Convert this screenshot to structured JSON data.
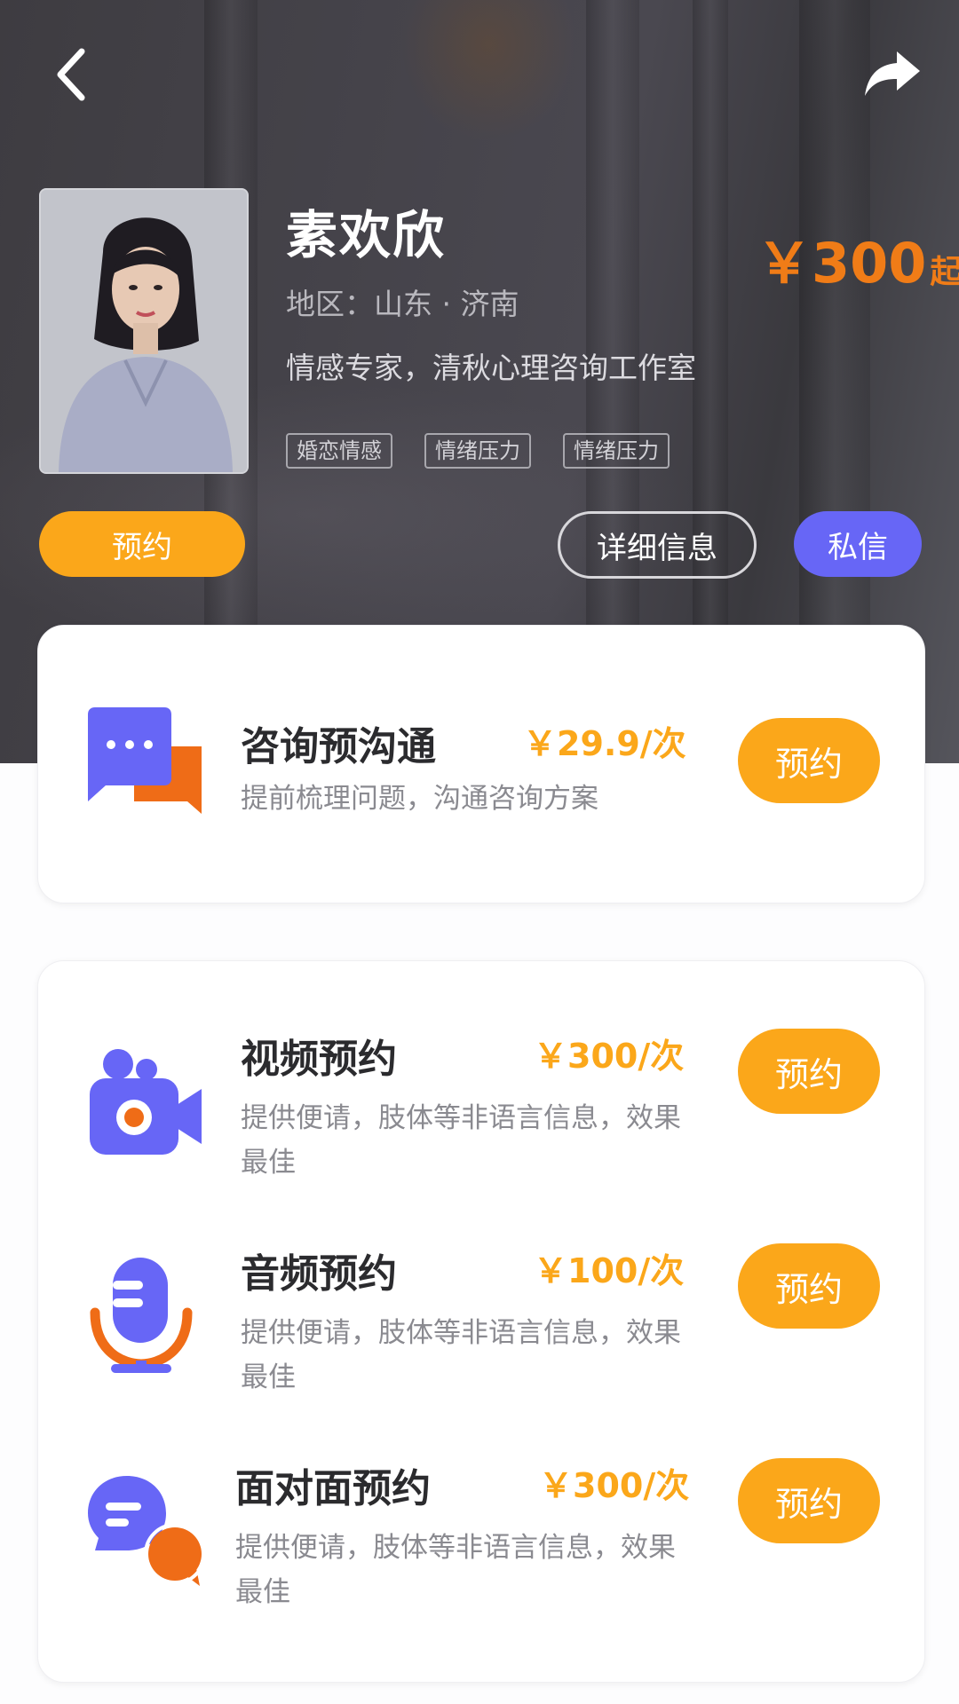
{
  "header": {
    "back_icon": "chevron-left-icon",
    "share_icon": "share-arrow-icon"
  },
  "profile": {
    "name": "素欢欣",
    "region": "地区：山东 · 济南",
    "title": "情感专家，清秋心理咨询工作室",
    "tags": [
      "婚恋情感",
      "情绪压力",
      "情绪压力"
    ],
    "price": "￥300",
    "price_suffix": "起",
    "book_label": "预约",
    "detail_label": "详细信息",
    "message_label": "私信"
  },
  "colors": {
    "accent_orange": "#fba71a",
    "price_orange": "#f07c17",
    "accent_purple": "#6766f6",
    "icon_orange": "#ef6c17"
  },
  "pre_consult": {
    "name": "咨询预沟通",
    "price": "￥29.9/次",
    "desc": "提前梳理问题，沟通咨询方案",
    "book_label": "预约",
    "icon": "chat-bubbles-icon"
  },
  "services": [
    {
      "name": "视频预约",
      "price": "￥300/次",
      "desc": "提供便请，肢体等非语言信息，效果最佳",
      "book_label": "预约",
      "icon": "video-camera-icon"
    },
    {
      "name": "音频预约",
      "price": "￥100/次",
      "desc": "提供便请，肢体等非语言信息，效果最佳",
      "book_label": "预约",
      "icon": "microphone-icon"
    },
    {
      "name": "面对面预约",
      "price": "￥300/次",
      "desc": "提供便请，肢体等非语言信息，效果最佳",
      "book_label": "预约",
      "icon": "face-to-face-chat-icon"
    }
  ]
}
